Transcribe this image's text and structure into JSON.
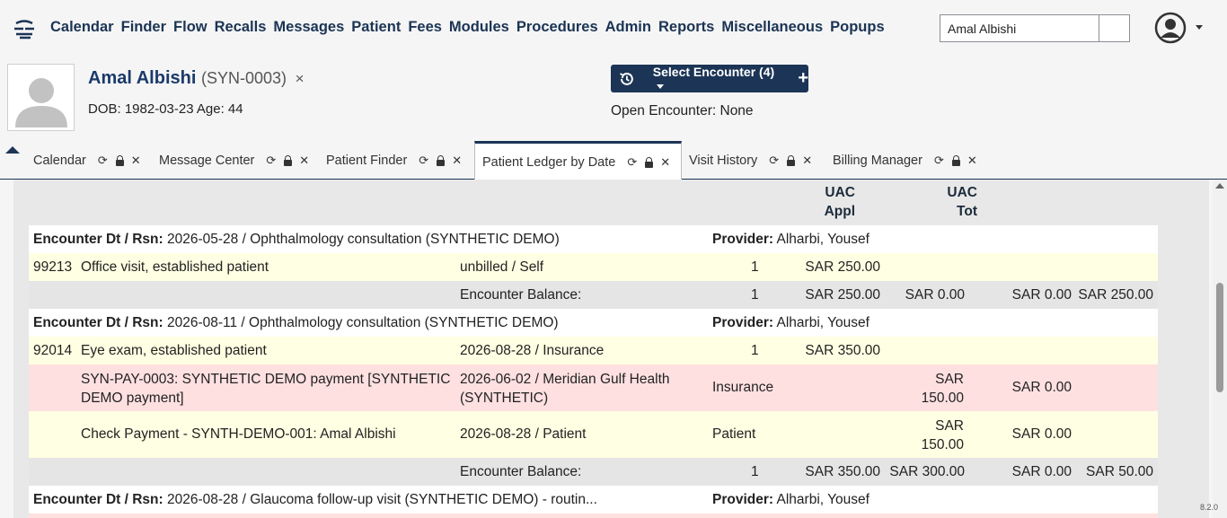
{
  "nav": {
    "menu": [
      "Calendar",
      "Finder",
      "Flow",
      "Recalls",
      "Messages",
      "Patient",
      "Fees",
      "Modules",
      "Procedures",
      "Admin",
      "Reports",
      "Miscellaneous",
      "Popups"
    ],
    "search_value": "Amal Albishi"
  },
  "patient": {
    "name": "Amal Albishi",
    "id": "(SYN-0003)",
    "close": "×",
    "dob": "DOB: 1982-03-23 Age: 44"
  },
  "encounter": {
    "select_label": "Select Encounter",
    "count": "(4)",
    "plus": "+",
    "open_text": "Open Encounter: None"
  },
  "tabs": [
    {
      "label": "Calendar"
    },
    {
      "label": "Message Center"
    },
    {
      "label": "Patient Finder"
    },
    {
      "label": "Patient Ledger by Date",
      "active": true
    },
    {
      "label": "Visit History"
    },
    {
      "label": "Billing Manager"
    }
  ],
  "ledger": {
    "headers": {
      "uac_appl_1": "UAC",
      "uac_appl_2": "Appl",
      "uac_tot_1": "UAC",
      "uac_tot_2": "Tot"
    },
    "enc1": {
      "label": "Encounter Dt / Rsn:",
      "text": "2026-05-28 / Ophthalmology consultation (SYNTHETIC DEMO)",
      "prov_label": "Provider:",
      "prov": "Alharbi, Yousef"
    },
    "line1": {
      "code": "99213",
      "desc": "Office visit, established patient",
      "status": "unbilled / Self",
      "qty": "1",
      "amt": "SAR 250.00"
    },
    "bal1": {
      "label": "Encounter Balance:",
      "qty": "1",
      "charges": "SAR 250.00",
      "paid": "SAR 0.00",
      "adj": "SAR 0.00",
      "bal": "SAR 250.00"
    },
    "enc2": {
      "label": "Encounter Dt / Rsn:",
      "text": "2026-08-11 / Ophthalmology consultation (SYNTHETIC DEMO)",
      "prov_label": "Provider:",
      "prov": "Alharbi, Yousef"
    },
    "line2": {
      "code": "92014",
      "desc": "Eye exam, established patient",
      "status": "2026-08-28 / Insurance",
      "qty": "1",
      "amt": "SAR 350.00"
    },
    "pay1": {
      "desc1": "SYN-PAY-0003: SYNTHETIC DEMO payment [SYNTHETIC",
      "desc2": "DEMO payment]",
      "src1": "2026-06-02 / Meridian Gulf Health",
      "src2": "(SYNTHETIC)",
      "type": "Insurance",
      "amt1": "SAR",
      "amt2": "150.00",
      "adj": "SAR 0.00"
    },
    "pay2": {
      "desc": "Check Payment - SYNTH-DEMO-001: Amal Albishi",
      "src": "2026-08-28 / Patient",
      "type": "Patient",
      "amt1": "SAR",
      "amt2": "150.00",
      "adj": "SAR 0.00"
    },
    "bal2": {
      "label": "Encounter Balance:",
      "qty": "1",
      "charges": "SAR 350.00",
      "paid": "SAR 300.00",
      "adj": "SAR 0.00",
      "bal": "SAR 50.00"
    },
    "enc3": {
      "label": "Encounter Dt / Rsn:",
      "text": "2026-08-28 / Glaucoma follow-up visit (SYNTHETIC DEMO) - routin...",
      "prov_label": "Provider:",
      "prov": "Alharbi, Yousef"
    }
  },
  "version": "8.2.0",
  "colors": {
    "brand": "#1c3556",
    "row_yellow": "#ffffe3",
    "row_pink": "#ffe0e0",
    "row_gray": "#e5e5e5"
  }
}
